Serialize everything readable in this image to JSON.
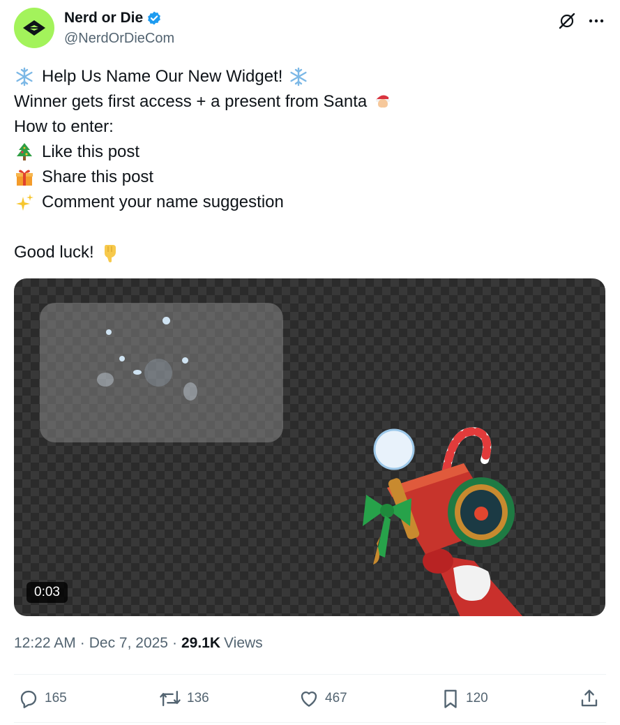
{
  "author": {
    "display_name": "Nerd or Die",
    "handle": "@NerdOrDieCom",
    "avatar_color": "#a3f35b",
    "verified_color": "#1d9bf0"
  },
  "tweet": {
    "lines": [
      {
        "lead_icon": "snowflake-emoji",
        "text": "Help Us Name Our New Widget!",
        "trail_icon": "snowflake-emoji"
      },
      {
        "text": "Winner gets first access + a present from Santa",
        "trail_icon": "santa-emoji"
      },
      {
        "text": "How to enter:"
      },
      {
        "lead_icon": "christmas-tree-emoji",
        "text": "Like this post"
      },
      {
        "lead_icon": "gift-emoji",
        "text": "Share this post"
      },
      {
        "lead_icon": "sparkles-emoji",
        "text": "Comment your name suggestion"
      },
      {
        "text": ""
      },
      {
        "text": "Good luck!",
        "trail_icon": "pointing-down-emoji"
      }
    ]
  },
  "media": {
    "duration": "0:03"
  },
  "meta": {
    "time": "12:22 AM",
    "separator": "·",
    "date": "Dec 7, 2025",
    "views_count": "29.1K",
    "views_label": "Views"
  },
  "actions": {
    "replies": "165",
    "reposts": "136",
    "likes": "467",
    "bookmarks": "120"
  }
}
